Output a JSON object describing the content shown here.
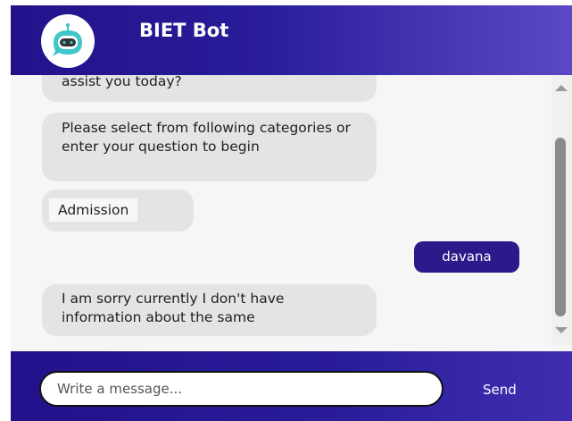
{
  "header": {
    "bot_name": "BIET Bot",
    "avatar_icon": "robot-icon"
  },
  "messages": [
    {
      "from": "bot",
      "text": "assist you today?"
    },
    {
      "from": "bot",
      "text": "Please select from following categories or enter your question to begin"
    },
    {
      "from": "bot",
      "button_label": "Admission"
    },
    {
      "from": "user",
      "text": "davana"
    },
    {
      "from": "bot",
      "text": "I am sorry currently I don't have information about the same"
    }
  ],
  "composer": {
    "placeholder": "Write a message...",
    "send_label": "Send"
  },
  "colors": {
    "header": "#22128a",
    "user_bubble": "#2b1a8a",
    "bot_bubble": "#e4e4e4",
    "accent": "#3ec6c9"
  }
}
